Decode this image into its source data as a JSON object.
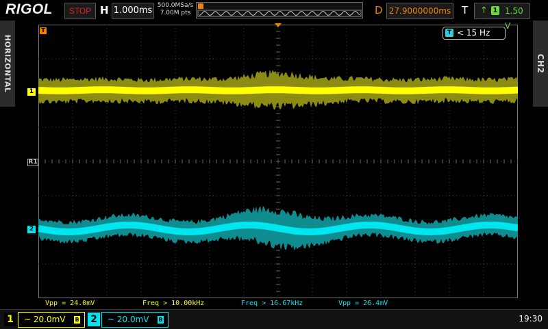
{
  "topbar": {
    "brand": "RIGOL",
    "run_status": "STOP",
    "h_label": "H",
    "timebase": "1.000ms",
    "sample_rate": "500.0MSa/s",
    "memory_depth": "7.00M pts",
    "d_label": "D",
    "delay": "27.9000000ms",
    "t_label": "T",
    "trigger_source": "1",
    "trigger_level": "1.50 V"
  },
  "side": {
    "left_tab": "HORIZONTAL",
    "right_tab": "CH2"
  },
  "screen": {
    "filter_readout": "< 15 Hz",
    "marker_ch1": "1",
    "marker_ch2": "2",
    "marker_ref": "R1",
    "marker_trigger": "T"
  },
  "measurements": [
    {
      "text": "Vpp = 24.0mV",
      "channel": 1
    },
    {
      "text": "Freq > 10.00kHz",
      "channel": 1
    },
    {
      "text": "Freq > 16.67kHz",
      "channel": 2
    },
    {
      "text": "Vpp = 26.4mV",
      "channel": 2
    }
  ],
  "channels": {
    "ch1": {
      "number": "1",
      "scale": "~ 20.0mV",
      "bw_icon": "B"
    },
    "ch2": {
      "number": "2",
      "scale": "~ 20.0mV",
      "bw_icon": "B"
    }
  },
  "clock": "19:30",
  "colors": {
    "ch1": "#ffff00",
    "ch2": "#00e6f0",
    "trigger": "#f08000",
    "status_stop": "#e02020",
    "trigger_level": "#6bdc3a"
  }
}
